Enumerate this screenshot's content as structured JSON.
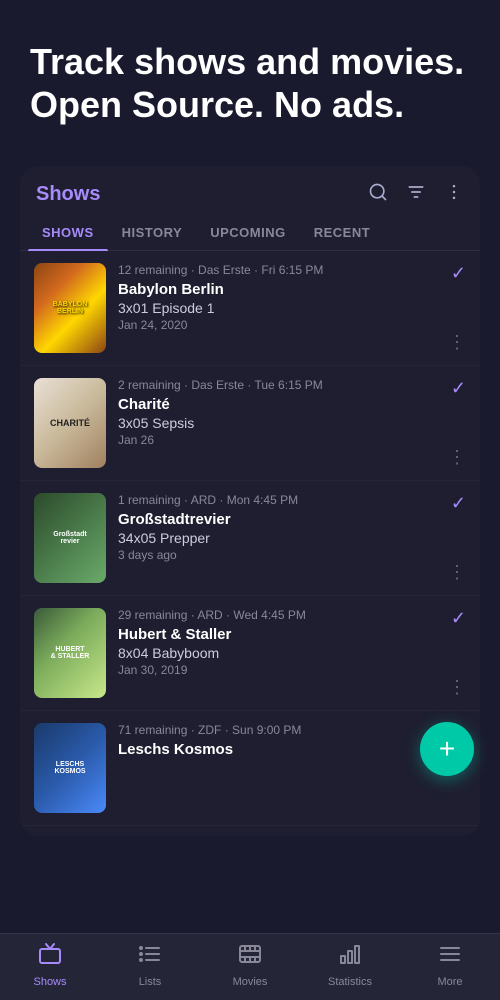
{
  "hero": {
    "title": "Track shows and movies. Open Source. No ads."
  },
  "card": {
    "title": "Shows",
    "tabs": [
      "SHOWS",
      "HISTORY",
      "UPCOMING",
      "RECENT"
    ],
    "active_tab": "SHOWS"
  },
  "shows": [
    {
      "id": "babylon",
      "meta": "12 remaining · Das Erste · Fri 6:15 PM",
      "title": "Babylon Berlin",
      "episode": "3x01 Episode 1",
      "date": "Jan 24, 2020",
      "poster_label": "BABYLON\nBERLIN",
      "poster_type": "babylon"
    },
    {
      "id": "charite",
      "meta": "2 remaining · Das Erste · Tue 6:15 PM",
      "title": "Charité",
      "episode": "3x05 Sepsis",
      "date": "Jan 26",
      "poster_label": "CHARITÉ",
      "poster_type": "charite"
    },
    {
      "id": "grossstadt",
      "meta": "1 remaining · ARD · Mon 4:45 PM",
      "title": "Großstadtrevier",
      "episode": "34x05 Prepper",
      "date": "3 days ago",
      "poster_label": "Großstadt\nrevier",
      "poster_type": "grossstadt"
    },
    {
      "id": "hubert",
      "meta": "29 remaining · ARD · Wed 4:45 PM",
      "title": "Hubert & Staller",
      "episode": "8x04 Babyboom",
      "date": "Jan 30, 2019",
      "poster_label": "HUBERT\n& STALLER",
      "poster_type": "hubert"
    },
    {
      "id": "leschs",
      "meta": "71 remaining · ZDF · Sun 9:00 PM",
      "title": "Leschs Kosmos",
      "episode": "",
      "date": "",
      "poster_label": "LESCHS\nKOSMOS",
      "poster_type": "leschs"
    }
  ],
  "fab": {
    "icon": "+"
  },
  "bottom_nav": {
    "items": [
      {
        "id": "shows",
        "label": "Shows",
        "active": true,
        "icon": "tv"
      },
      {
        "id": "lists",
        "label": "Lists",
        "active": false,
        "icon": "lists"
      },
      {
        "id": "movies",
        "label": "Movies",
        "active": false,
        "icon": "movies"
      },
      {
        "id": "statistics",
        "label": "Statistics",
        "active": false,
        "icon": "statistics"
      },
      {
        "id": "more",
        "label": "More",
        "active": false,
        "icon": "more"
      }
    ]
  }
}
